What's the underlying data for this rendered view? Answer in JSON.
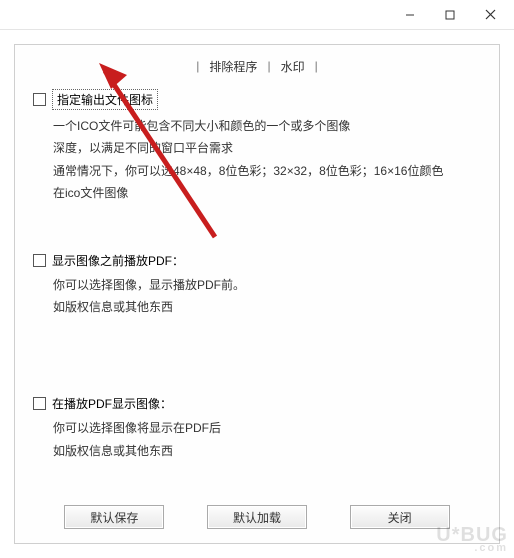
{
  "titlebar": {
    "minimize_icon": "minimize-icon",
    "maximize_icon": "maximize-icon",
    "close_icon": "close-icon"
  },
  "tabs": {
    "tab1": "排除程序",
    "tab2": "水印"
  },
  "section1": {
    "checkbox_label": "指定输出文件图标",
    "line1": "一个ICO文件可能包含不同大小和颜色的一个或多个图像",
    "line2": "深度，以满足不同的窗口平台需求",
    "line3": "通常情况下，你可以选48×48，8位色彩；32×32，8位色彩；16×16位颜色",
    "line4": "在ico文件图像"
  },
  "section2": {
    "checkbox_label": "显示图像之前播放PDF：",
    "line1": "你可以选择图像，显示播放PDF前。",
    "line2": "如版权信息或其他东西"
  },
  "section3": {
    "checkbox_label": "在播放PDF显示图像：",
    "line1": "你可以选择图像将显示在PDF后",
    "line2": "如版权信息或其他东西"
  },
  "buttons": {
    "save_default": "默认保存",
    "load_default": "默认加载",
    "close": "关闭"
  },
  "watermark": {
    "big": "BUG",
    "small": ".com",
    "prefix": "U"
  }
}
